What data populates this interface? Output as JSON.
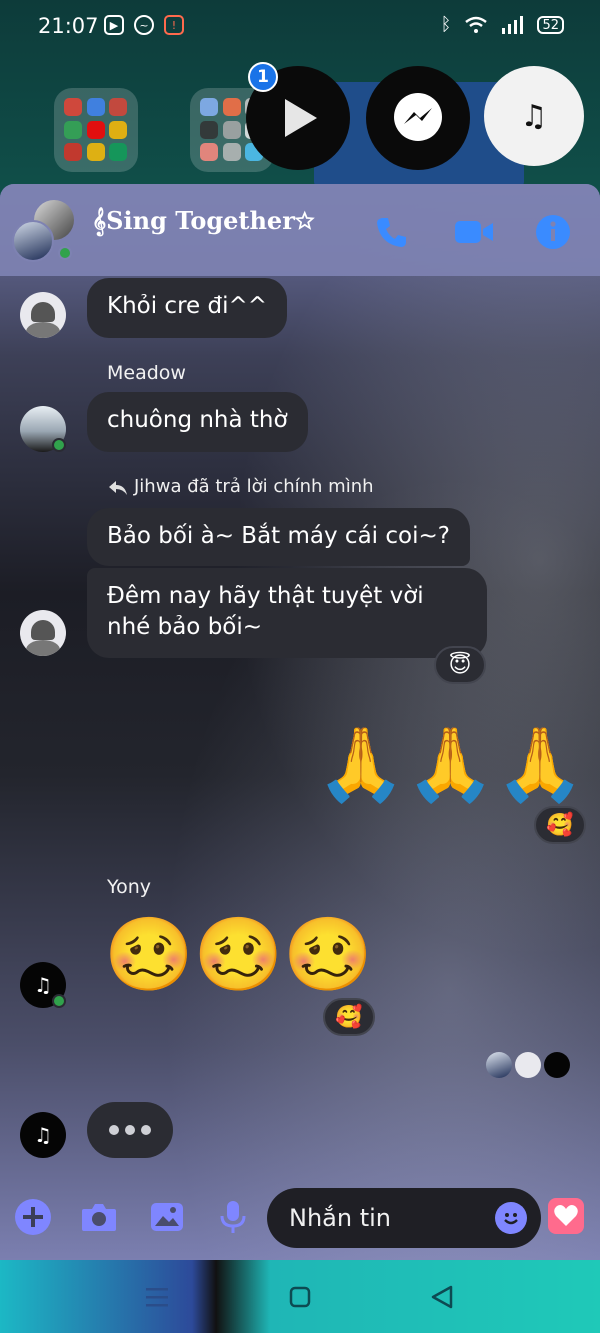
{
  "status_bar": {
    "time": "21:07",
    "battery": "52"
  },
  "home_bubbles": {
    "badge_count": "1"
  },
  "header": {
    "title": "𝄞Sing Together☆"
  },
  "messages": [
    {
      "text": "Khỏi cre đi^^"
    },
    {
      "sender": "Meadow",
      "text": "chuông nhà thờ"
    },
    {
      "reply_note": "Jihwa đã trả lời chính mình",
      "text": "Bảo bối à~ Bắt máy cái coi~?"
    },
    {
      "text": "Đêm nay hãy thật tuyệt vời nhé bảo bối~",
      "reaction": "😇"
    },
    {
      "emoji": "🙏🙏🙏",
      "reaction": "🥰"
    },
    {
      "sender": "Yony",
      "emoji": "🥴🥴🥴",
      "reaction": "🥰"
    }
  ],
  "composer": {
    "placeholder": "Nhắn tin"
  },
  "colors": {
    "header_bg": "#7e82b2",
    "accent": "#7f86ff",
    "bubble_bg": "#2b2c33",
    "online": "#31a24c"
  }
}
